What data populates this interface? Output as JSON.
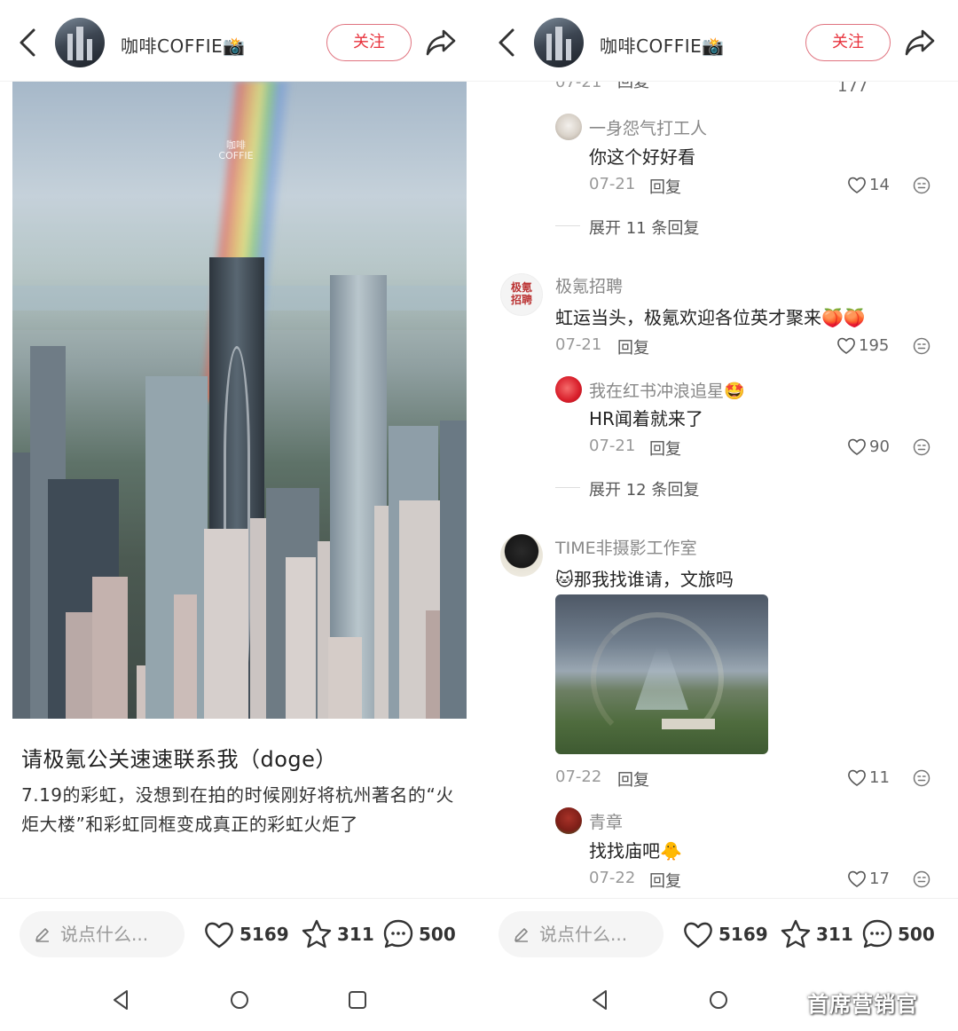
{
  "header": {
    "author": "咖啡COFFIE📸",
    "follow_label": "关注",
    "back_icon": "chevron-left-icon",
    "share_icon": "share-arrow-icon"
  },
  "post": {
    "title": "请极氪公关速速联系我（doge）",
    "description": "7.19的彩虹，没想到在拍的时候刚好将杭州著名的“火炬大楼”和彩虹同框变成真正的彩虹火炬了",
    "photo_watermark": "咖啡 COFFIE"
  },
  "bottom_bar": {
    "input_placeholder": "说点什么...",
    "likes": "5169",
    "stars": "311",
    "comments": "500"
  },
  "comments": {
    "top_partial": {
      "date": "07-21",
      "reply": "回复",
      "likes": "177"
    },
    "c1": {
      "name": "一身怨气打工人",
      "text": "你这个好好看",
      "date": "07-21",
      "reply": "回复",
      "likes": "14",
      "expand": "展开 11 条回复"
    },
    "c2": {
      "name": "极氪招聘",
      "avatar_text": "极氪招聘",
      "text": "虹运当头，极氪欢迎各位英才聚来🍑🍑",
      "date": "07-21",
      "reply": "回复",
      "likes": "195"
    },
    "c2r": {
      "name": "我在红书冲浪追星🤩",
      "text": "HR闻着就来了",
      "date": "07-21",
      "reply": "回复",
      "likes": "90",
      "expand": "展开 12 条回复"
    },
    "c3": {
      "name": "TIME非摄影工作室",
      "text": "🐱那我找谁请，文旅吗",
      "date": "07-22",
      "reply": "回复",
      "likes": "11"
    },
    "c3r": {
      "name": "青章",
      "text": "找找庙吧🐥",
      "date": "07-22",
      "reply": "回复",
      "likes": "17"
    }
  },
  "credit": "首席营销官",
  "colors": {
    "accent": "#e8323c",
    "follow_border": "#e0737f"
  }
}
